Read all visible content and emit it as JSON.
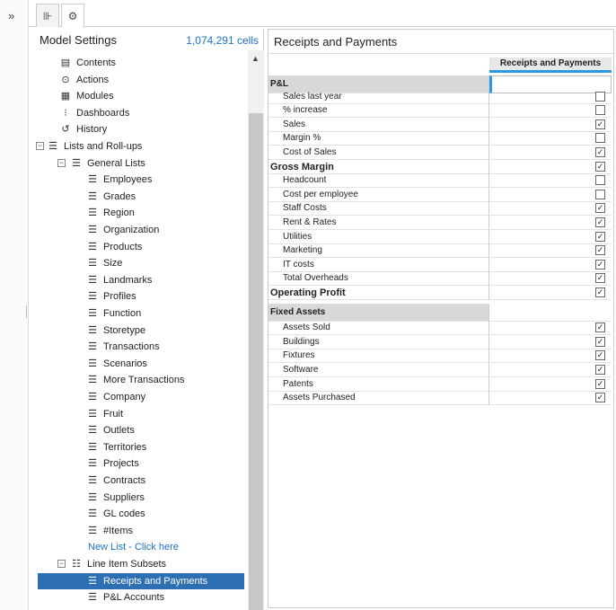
{
  "rail": {
    "expand_icon": "double-chevron-right-icon",
    "expand_glyph": "»"
  },
  "tabs": [
    {
      "name": "hierarchy-tab",
      "icon": "hierarchy-icon",
      "glyph": "⊪"
    },
    {
      "name": "settings-tab",
      "icon": "gear-icon",
      "glyph": "⚙"
    }
  ],
  "left": {
    "title": "Model Settings",
    "cells": "1,074,291 cells",
    "tree": [
      {
        "label": "Contents",
        "icon": "contents-icon",
        "glyph": "▤",
        "level": 1
      },
      {
        "label": "Actions",
        "icon": "actions-icon",
        "glyph": "⊙",
        "level": 1
      },
      {
        "label": "Modules",
        "icon": "modules-icon",
        "glyph": "▦",
        "level": 1
      },
      {
        "label": "Dashboards",
        "icon": "dashboards-icon",
        "glyph": "⁝",
        "level": 1
      },
      {
        "label": "History",
        "icon": "history-icon",
        "glyph": "↺",
        "level": 1
      },
      {
        "label": "Lists and Roll-ups",
        "icon": "list-icon",
        "glyph": "☰",
        "level": 0,
        "toggle": "−"
      },
      {
        "label": "General Lists",
        "icon": "list-icon",
        "glyph": "☰",
        "level": 1,
        "toggle": "−"
      },
      {
        "label": "Employees",
        "icon": "list-icon",
        "glyph": "☰",
        "level": 3
      },
      {
        "label": "Grades",
        "icon": "list-icon",
        "glyph": "☰",
        "level": 3
      },
      {
        "label": "Region",
        "icon": "list-icon",
        "glyph": "☰",
        "level": 3
      },
      {
        "label": "Organization",
        "icon": "list-icon",
        "glyph": "☰",
        "level": 3
      },
      {
        "label": "Products",
        "icon": "list-icon",
        "glyph": "☰",
        "level": 3
      },
      {
        "label": "Size",
        "icon": "list-icon",
        "glyph": "☰",
        "level": 3
      },
      {
        "label": "Landmarks",
        "icon": "list-icon",
        "glyph": "☰",
        "level": 3
      },
      {
        "label": "Profiles",
        "icon": "list-icon",
        "glyph": "☰",
        "level": 3
      },
      {
        "label": "Function",
        "icon": "list-icon",
        "glyph": "☰",
        "level": 3
      },
      {
        "label": "Storetype",
        "icon": "list-icon",
        "glyph": "☰",
        "level": 3
      },
      {
        "label": "Transactions",
        "icon": "list-icon",
        "glyph": "☰",
        "level": 3
      },
      {
        "label": "Scenarios",
        "icon": "list-icon",
        "glyph": "☰",
        "level": 3
      },
      {
        "label": "More Transactions",
        "icon": "list-icon",
        "glyph": "☰",
        "level": 3
      },
      {
        "label": "Company",
        "icon": "list-icon",
        "glyph": "☰",
        "level": 3
      },
      {
        "label": "Fruit",
        "icon": "list-icon",
        "glyph": "☰",
        "level": 3
      },
      {
        "label": "Outlets",
        "icon": "list-icon",
        "glyph": "☰",
        "level": 3
      },
      {
        "label": "Territories",
        "icon": "list-icon",
        "glyph": "☰",
        "level": 3
      },
      {
        "label": "Projects",
        "icon": "list-icon",
        "glyph": "☰",
        "level": 3
      },
      {
        "label": "Contracts",
        "icon": "list-icon",
        "glyph": "☰",
        "level": 3
      },
      {
        "label": "Suppliers",
        "icon": "list-icon",
        "glyph": "☰",
        "level": 3
      },
      {
        "label": "GL codes",
        "icon": "list-icon",
        "glyph": "☰",
        "level": 3
      },
      {
        "label": "#Items",
        "icon": "list-icon",
        "glyph": "☰",
        "level": 3
      },
      {
        "label": "New List - Click here",
        "icon": "",
        "glyph": "",
        "level": 3,
        "link": true
      },
      {
        "label": "Line Item Subsets",
        "icon": "subset-icon",
        "glyph": "☷",
        "level": 1,
        "toggle": "−"
      },
      {
        "label": "Receipts and Payments",
        "icon": "list-icon",
        "glyph": "☰",
        "level": 3,
        "selected": true
      },
      {
        "label": "P&L Accounts",
        "icon": "list-icon",
        "glyph": "☰",
        "level": 3
      }
    ]
  },
  "right": {
    "title": "Receipts and Payments",
    "column_header": "Receipts and Payments",
    "rows": [
      {
        "label": "P&L",
        "kind": "section"
      },
      {
        "label": "Sales last year",
        "kind": "item",
        "checked": false
      },
      {
        "label": "% increase",
        "kind": "item",
        "checked": false
      },
      {
        "label": "Sales",
        "kind": "item",
        "checked": true
      },
      {
        "label": "Margin %",
        "kind": "item",
        "checked": false
      },
      {
        "label": "Cost of Sales",
        "kind": "item",
        "checked": true
      },
      {
        "label": "Gross Margin",
        "kind": "bold",
        "checked": true
      },
      {
        "label": "Headcount",
        "kind": "item",
        "checked": false
      },
      {
        "label": "Cost per employee",
        "kind": "item",
        "checked": false
      },
      {
        "label": "Staff Costs",
        "kind": "item",
        "checked": true
      },
      {
        "label": "Rent & Rates",
        "kind": "item",
        "checked": true
      },
      {
        "label": "Utilities",
        "kind": "item",
        "checked": true
      },
      {
        "label": "Marketing",
        "kind": "item",
        "checked": true
      },
      {
        "label": "IT costs",
        "kind": "item",
        "checked": true
      },
      {
        "label": "Total Overheads",
        "kind": "item",
        "checked": true
      },
      {
        "label": "Operating Profit",
        "kind": "bold",
        "checked": true
      },
      {
        "label": "Fixed Assets",
        "kind": "section2"
      },
      {
        "label": "Assets Sold",
        "kind": "item",
        "checked": true
      },
      {
        "label": "Buildings",
        "kind": "item",
        "checked": true
      },
      {
        "label": "Fixtures",
        "kind": "item",
        "checked": true
      },
      {
        "label": "Software",
        "kind": "item",
        "checked": true
      },
      {
        "label": "Patents",
        "kind": "item",
        "checked": true
      },
      {
        "label": "Assets Purchased",
        "kind": "item",
        "checked": true
      }
    ]
  },
  "colors": {
    "accent": "#2a9be0",
    "selected_bg": "#2d6fb2",
    "link": "#1a73c8"
  }
}
